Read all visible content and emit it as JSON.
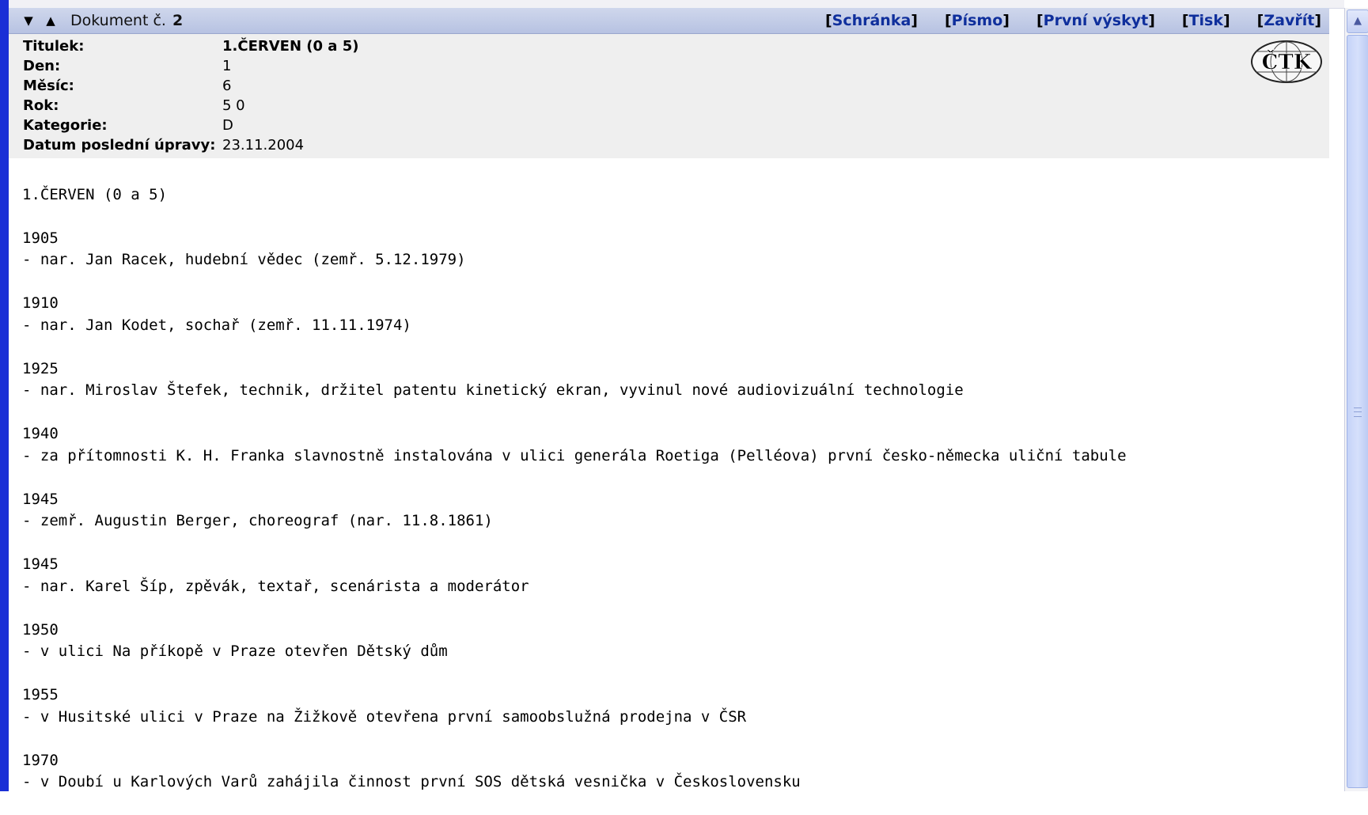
{
  "titlebar": {
    "collapse_icon": "triangle-down-icon",
    "expand_icon": "triangle-up-icon",
    "doc_label": "Dokument č.",
    "doc_number": "2",
    "links": [
      {
        "open": "[",
        "label": "Schránka",
        "close": "]"
      },
      {
        "open": "[",
        "label": "Písmo",
        "close": "]"
      },
      {
        "open": "[",
        "label": "První výskyt",
        "close": "]"
      },
      {
        "open": "[",
        "label": "Tisk",
        "close": "]"
      },
      {
        "open": "[",
        "label": "Zavřít",
        "close": "]"
      }
    ]
  },
  "metadata": {
    "rows": [
      {
        "label": "Titulek:",
        "value": "1.ČERVEN (0 a 5)"
      },
      {
        "label": "Den:",
        "value": "1"
      },
      {
        "label": "Měsíc:",
        "value": "6"
      },
      {
        "label": "Rok:",
        "value": "5 0"
      },
      {
        "label": "Kategorie:",
        "value": "D"
      },
      {
        "label": "Datum poslední úpravy:",
        "value": "23.11.2004"
      }
    ],
    "logo_text": "ČTK"
  },
  "content": {
    "heading": "1.ČERVEN (0 a 5)",
    "entries": [
      {
        "year": "1905",
        "text": "- nar. Jan Racek, hudební vědec (zemř. 5.12.1979)"
      },
      {
        "year": "1910",
        "text": "- nar. Jan Kodet, sochař (zemř. 11.11.1974)"
      },
      {
        "year": "1925",
        "text": "- nar. Miroslav Štefek, technik, držitel patentu kinetický ekran, vyvinul nové audiovizuální technologie"
      },
      {
        "year": "1940",
        "text": "- za přítomnosti K. H. Franka slavnostně instalována v ulici generála Roetiga (Pelléova) první česko-německa uliční tabule"
      },
      {
        "year": "1945",
        "text": "- zemř. Augustin Berger, choreograf (nar. 11.8.1861)"
      },
      {
        "year": "1945",
        "text": "- nar. Karel Šíp, zpěvák, textař, scenárista a moderátor"
      },
      {
        "year": "1950",
        "text": "- v ulici Na příkopě v Praze otevřen Dětský dům"
      },
      {
        "year": "1955",
        "text": "- v Husitské ulici v Praze na Žižkově otevřena první samoobslužná prodejna v ČSR"
      },
      {
        "year": "1970",
        "text": "- v Doubí u Karlových Varů zahájila činnost první SOS dětská vesnička v Československu"
      }
    ]
  },
  "scrollbar": {
    "up_icon": "scroll-up-arrow-icon"
  }
}
